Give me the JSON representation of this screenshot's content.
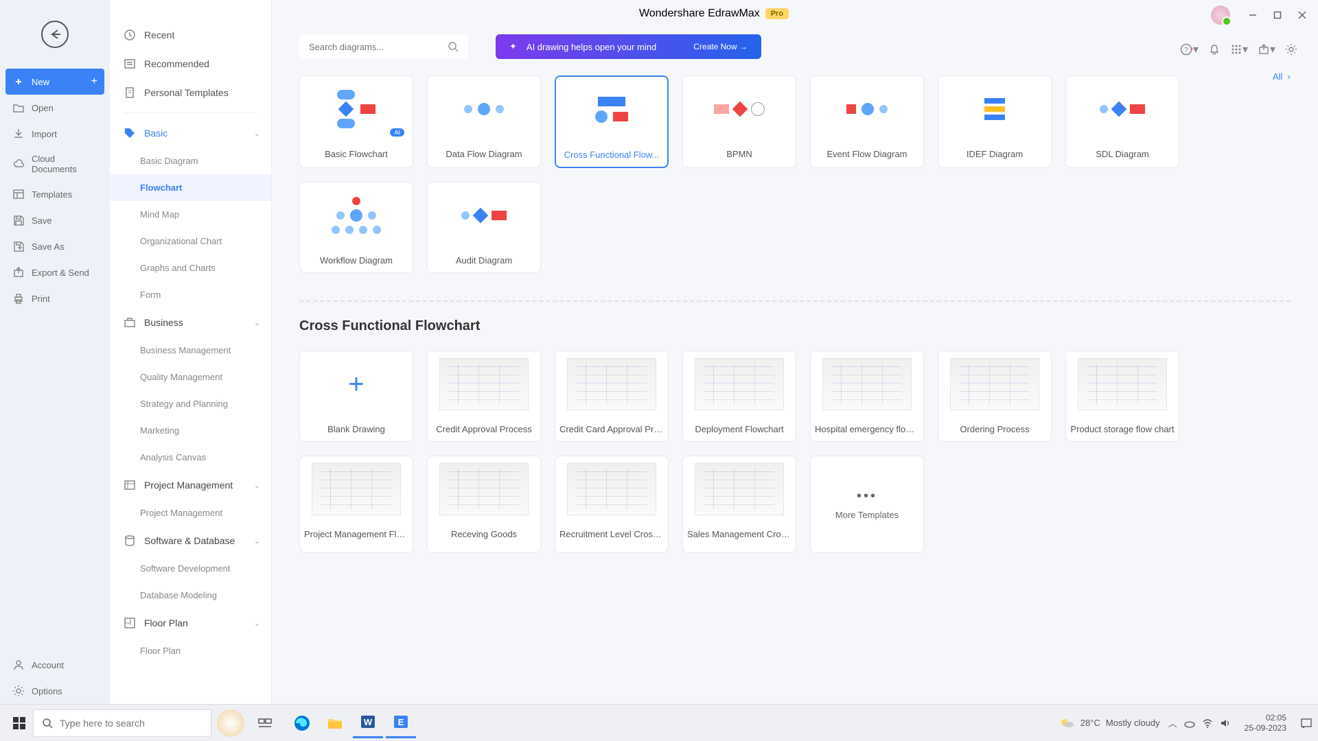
{
  "titlebar": {
    "app_name": "Wondershare EdrawMax",
    "badge": "Pro"
  },
  "sidebar_left": {
    "items": [
      {
        "label": "New",
        "icon": "plus-square",
        "active": true,
        "has_add": true
      },
      {
        "label": "Open",
        "icon": "folder-open"
      },
      {
        "label": "Import",
        "icon": "import"
      },
      {
        "label": "Cloud Documents",
        "icon": "cloud"
      },
      {
        "label": "Templates",
        "icon": "templates"
      },
      {
        "label": "Save",
        "icon": "save"
      },
      {
        "label": "Save As",
        "icon": "save-as"
      },
      {
        "label": "Export & Send",
        "icon": "export"
      },
      {
        "label": "Print",
        "icon": "print"
      }
    ],
    "bottom": [
      {
        "label": "Account",
        "icon": "account"
      },
      {
        "label": "Options",
        "icon": "gear"
      }
    ]
  },
  "nav_panel": {
    "top": [
      {
        "label": "Recent",
        "icon": "clock"
      },
      {
        "label": "Recommended",
        "icon": "star-list"
      },
      {
        "label": "Personal Templates",
        "icon": "doc"
      }
    ],
    "groups": [
      {
        "label": "Basic",
        "icon": "tag",
        "active": true,
        "items": [
          "Basic Diagram",
          "Flowchart",
          "Mind Map",
          "Organizational Chart",
          "Graphs and Charts",
          "Form"
        ],
        "active_item": "Flowchart"
      },
      {
        "label": "Business",
        "icon": "briefcase",
        "items": [
          "Business Management",
          "Quality Management",
          "Strategy and Planning",
          "Marketing",
          "Analysis Canvas"
        ]
      },
      {
        "label": "Project Management",
        "icon": "project",
        "items": [
          "Project Management"
        ]
      },
      {
        "label": "Software & Database",
        "icon": "database",
        "items": [
          "Software Development",
          "Database Modeling"
        ]
      },
      {
        "label": "Floor Plan",
        "icon": "floorplan",
        "items": [
          "Floor Plan"
        ]
      }
    ]
  },
  "search": {
    "placeholder": "Search diagrams..."
  },
  "ai_banner": {
    "text": "AI drawing helps open your mind",
    "cta": "Create Now"
  },
  "all_link": "All",
  "diagram_types": [
    {
      "label": "Basic Flowchart",
      "ai": true
    },
    {
      "label": "Data Flow Diagram"
    },
    {
      "label": "Cross Functional Flow...",
      "selected": true
    },
    {
      "label": "BPMN"
    },
    {
      "label": "Event Flow Diagram"
    },
    {
      "label": "IDEF Diagram"
    },
    {
      "label": "SDL Diagram"
    },
    {
      "label": "Workflow Diagram"
    },
    {
      "label": "Audit Diagram"
    }
  ],
  "section_title": "Cross Functional Flowchart",
  "templates": [
    {
      "label": "Blank Drawing",
      "blank": true
    },
    {
      "label": "Credit Approval Process"
    },
    {
      "label": "Credit Card Approval Proc..."
    },
    {
      "label": "Deployment Flowchart"
    },
    {
      "label": "Hospital emergency flow c..."
    },
    {
      "label": "Ordering Process"
    },
    {
      "label": "Product storage flow chart"
    },
    {
      "label": "Project Management Flow..."
    },
    {
      "label": "Receving Goods"
    },
    {
      "label": "Recruitment Level Cross F..."
    },
    {
      "label": "Sales Management Crossf..."
    },
    {
      "label": "More Templates",
      "more": true
    }
  ],
  "taskbar": {
    "search_placeholder": "Type here to search",
    "weather_temp": "28°C",
    "weather_text": "Mostly cloudy",
    "time": "02:05",
    "date": "25-09-2023"
  }
}
